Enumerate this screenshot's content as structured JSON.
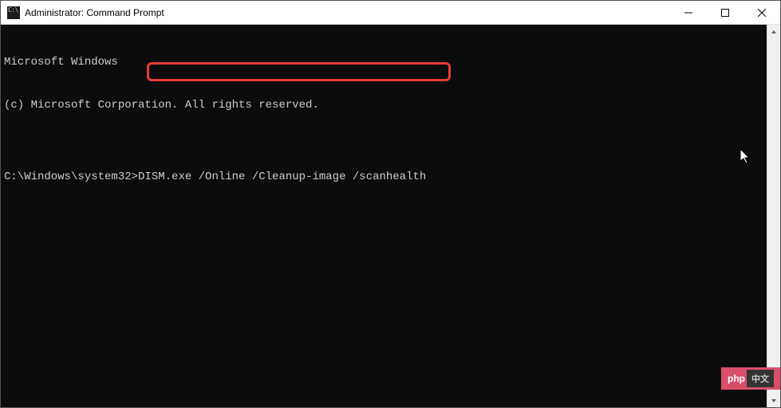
{
  "titlebar": {
    "icon_text": "C:\\",
    "title": "Administrator: Command Prompt"
  },
  "terminal": {
    "line1": "Microsoft Windows",
    "line2": "(c) Microsoft Corporation. All rights reserved.",
    "blank": "",
    "prompt": "C:\\Windows\\system32>",
    "command": "DISM.exe /Online /Cleanup-image /scanhealth"
  },
  "highlight": {
    "left": "183",
    "top": "77",
    "width": "381",
    "height": "24"
  },
  "watermark": {
    "text": "php"
  }
}
